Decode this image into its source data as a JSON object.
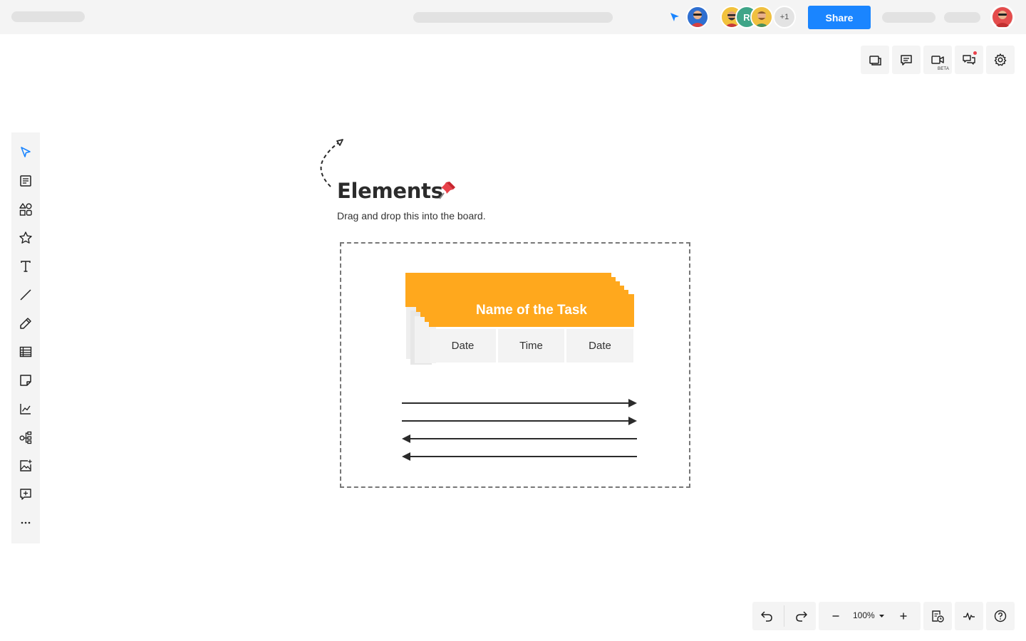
{
  "topbar": {
    "share_label": "Share",
    "collaborators_more": "+1",
    "collaborator_letter": "R"
  },
  "canvas": {
    "title": "Elements",
    "subtitle": "Drag and drop this into the board.",
    "task_card": {
      "name": "Name of the Task",
      "fields": [
        "Date",
        "Time",
        "Date"
      ]
    }
  },
  "right_tools": {
    "video_badge": "BETA"
  },
  "left_tools": [
    "select",
    "template",
    "shapes",
    "favorites",
    "text",
    "line",
    "pen",
    "table",
    "sticky-note",
    "chart",
    "mind-map",
    "image",
    "comment",
    "more"
  ],
  "bottom_toolbar": {
    "zoom_level": "100%"
  },
  "colors": {
    "accent": "#1a85ff",
    "task_header": "#ffa81d",
    "toolbar_bg": "#f4f4f4",
    "notification_dot": "#e8414a"
  }
}
